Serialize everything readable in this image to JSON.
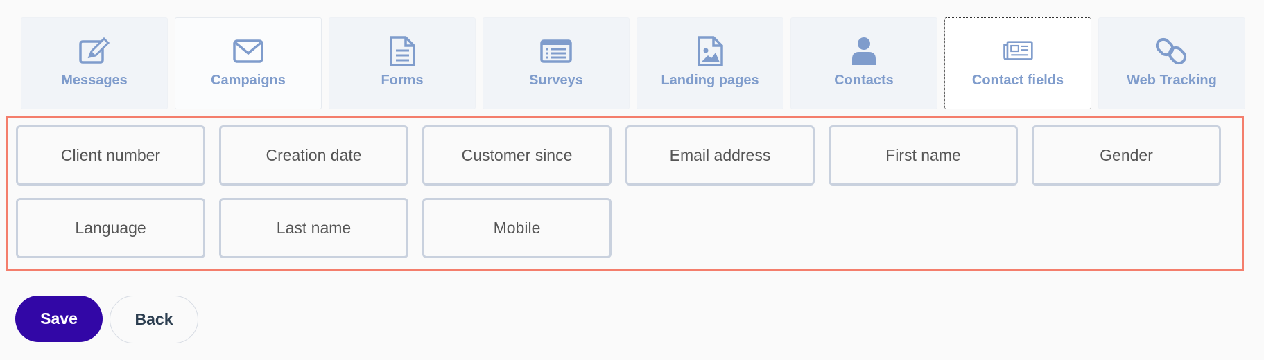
{
  "tabs": [
    {
      "label": "Messages",
      "icon": "edit-icon"
    },
    {
      "label": "Campaigns",
      "icon": "envelope-icon"
    },
    {
      "label": "Forms",
      "icon": "document-icon"
    },
    {
      "label": "Surveys",
      "icon": "list-icon"
    },
    {
      "label": "Landing pages",
      "icon": "image-file-icon"
    },
    {
      "label": "Contacts",
      "icon": "user-icon"
    },
    {
      "label": "Contact fields",
      "icon": "newspaper-icon",
      "active": true
    },
    {
      "label": "Web Tracking",
      "icon": "link-icon"
    }
  ],
  "fields": [
    "Client number",
    "Creation date",
    "Customer since",
    "Email address",
    "First name",
    "Gender",
    "Language",
    "Last name",
    "Mobile"
  ],
  "actions": {
    "save_label": "Save",
    "back_label": "Back"
  },
  "colors": {
    "accent": "#3207a6",
    "icon": "#7f9ccc",
    "highlight_border": "#f47e6c"
  }
}
